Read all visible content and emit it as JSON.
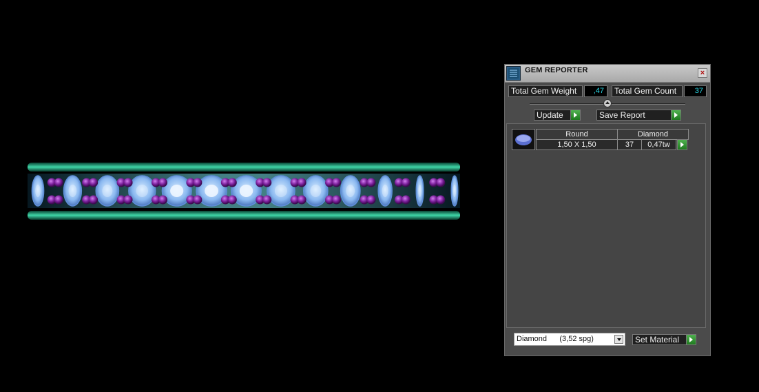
{
  "panel": {
    "title": "GEM REPORTER",
    "close_glyph": "×",
    "icon": "gem-reporter-app-icon",
    "total_gem_weight_label": "Total Gem Weight",
    "total_gem_weight_value": ",47",
    "total_gem_count_label": "Total Gem Count",
    "total_gem_count_value": "37",
    "update_label": "Update",
    "save_report_label": "Save Report",
    "results": {
      "headers": [
        "Round",
        "Diamond"
      ],
      "rows": [
        {
          "size": "1,50 X 1,50",
          "count": "37",
          "weight": "0,47tw"
        }
      ]
    },
    "material_selected": "Diamond      (3,52 spg)",
    "set_material_label": "Set Material"
  },
  "colors": {
    "panel_bg": "#4b4b4b",
    "value_text": "#2ad8e6",
    "go_button": "#2f9a2f",
    "ring_metal": "#1fa27f",
    "prong": "#7a1f9a",
    "gem": "#7fb2f0"
  }
}
